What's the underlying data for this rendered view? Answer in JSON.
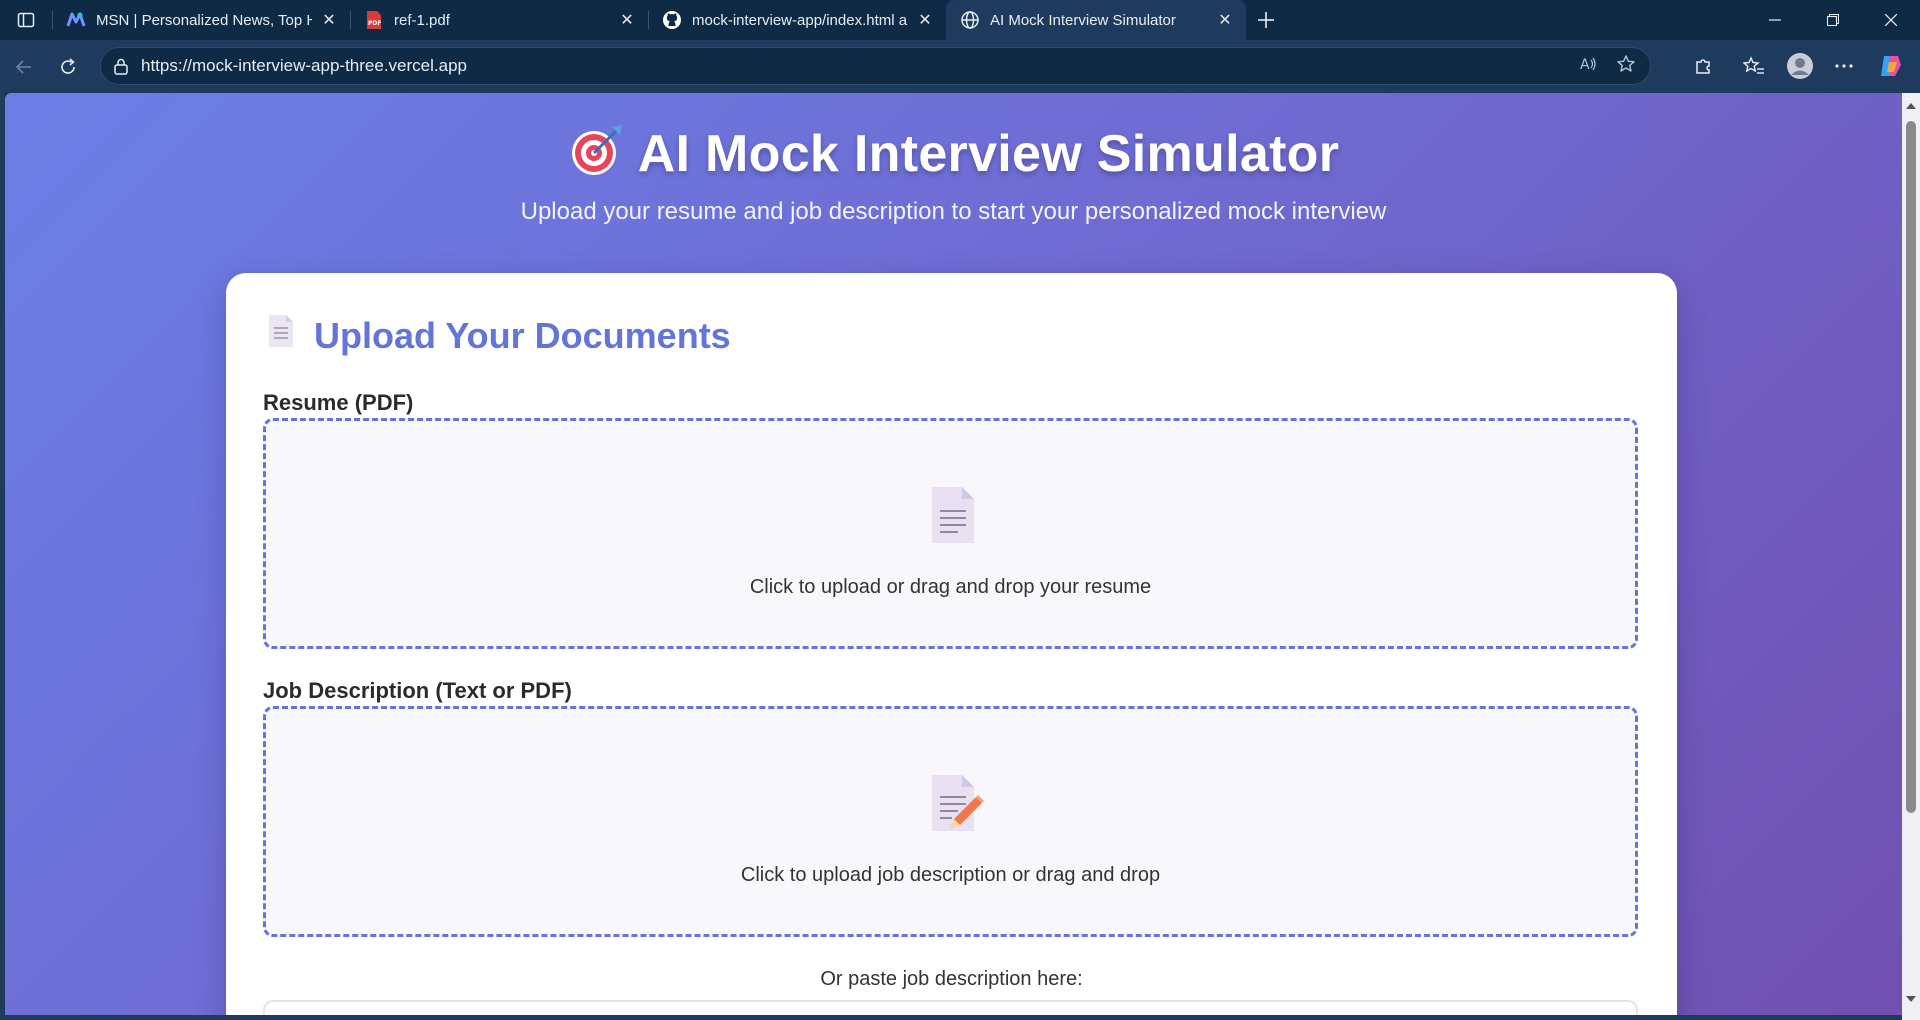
{
  "browser": {
    "tabs": [
      {
        "title": "MSN | Personalized News, Top He",
        "icon": "msn-icon",
        "active": false
      },
      {
        "title": "ref-1.pdf",
        "icon": "pdf-icon",
        "active": false
      },
      {
        "title": "mock-interview-app/index.html a",
        "icon": "github-icon",
        "active": false
      },
      {
        "title": "AI Mock Interview Simulator",
        "icon": "globe-icon",
        "active": true
      }
    ],
    "url": "https://mock-interview-app-three.vercel.app"
  },
  "page": {
    "title": "AI Mock Interview Simulator",
    "title_emoji": "🎯",
    "subtitle": "Upload your resume and job description to start your personalized mock interview",
    "card": {
      "heading": "Upload Your Documents",
      "heading_icon": "📄",
      "resume": {
        "label": "Resume (PDF)",
        "icon": "📄",
        "prompt": "Click to upload or drag and drop your resume"
      },
      "job": {
        "label": "Job Description (Text or PDF)",
        "icon": "📝",
        "prompt": "Click to upload job description or drag and drop"
      },
      "paste_label": "Or paste job description here:"
    }
  },
  "colors": {
    "accent": "#6474d8",
    "gradient_start": "#6a7fe6",
    "gradient_end": "#7050b0",
    "browser_chrome": "#0f2a44"
  }
}
